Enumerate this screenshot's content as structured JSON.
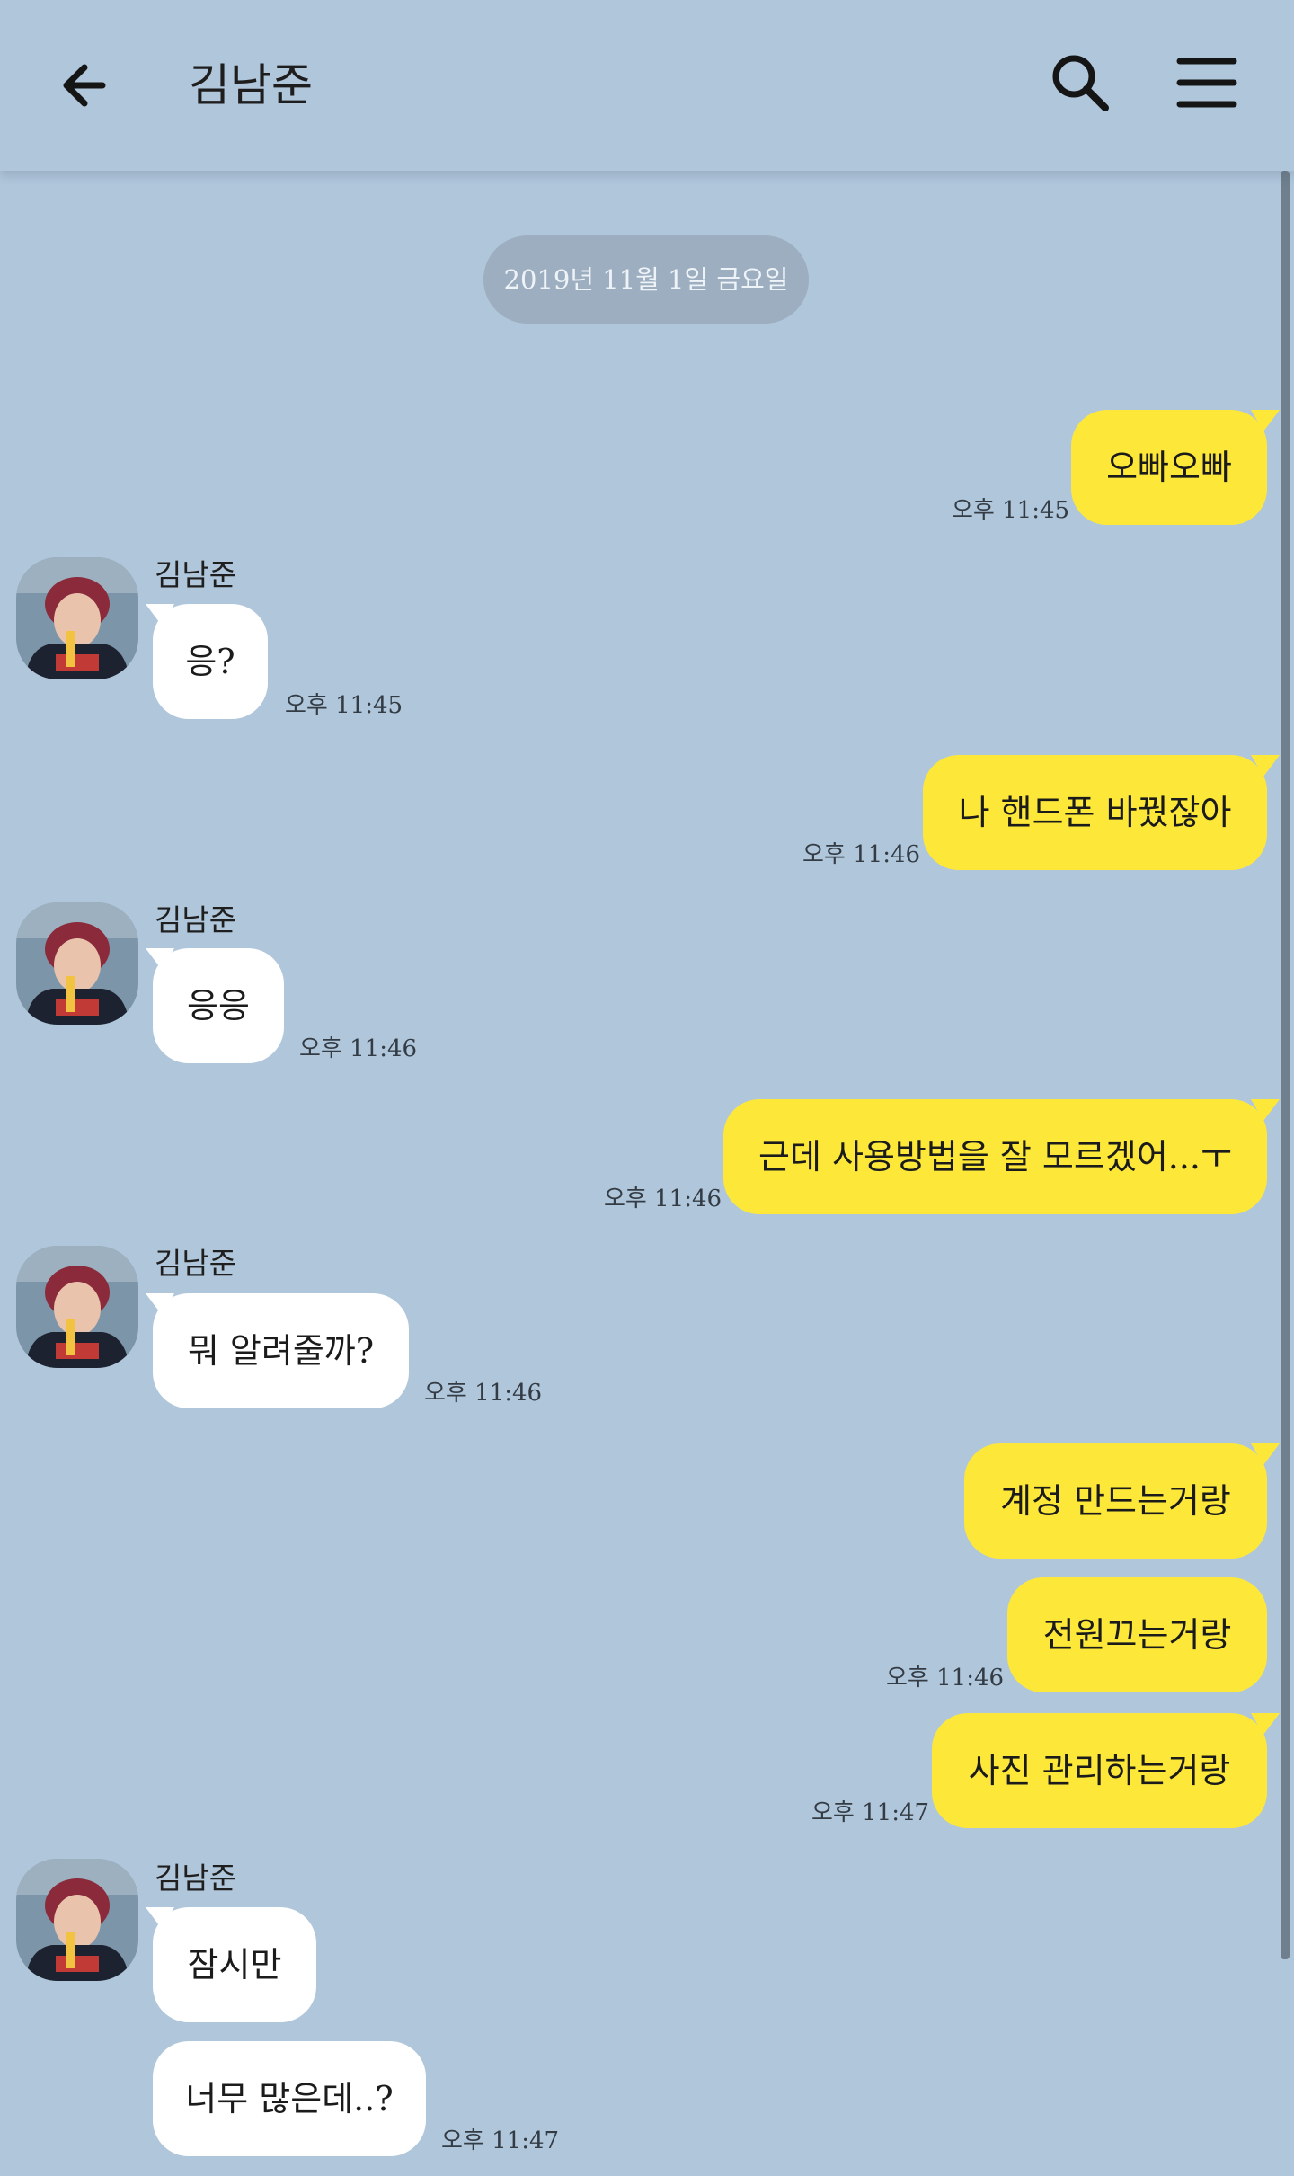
{
  "header": {
    "title": "김남준",
    "back_icon": "arrow-left-icon",
    "search_icon": "search-icon",
    "menu_icon": "hamburger-menu-icon"
  },
  "date_divider": "2019년 11월 1일 금요일",
  "colors": {
    "background": "#b0c6db",
    "my_bubble": "#fde83a",
    "their_bubble": "#ffffff",
    "date_pill": "#9caebf"
  },
  "messages": [
    {
      "from": "me",
      "text": "오빠오빠",
      "time": "오후 11:45"
    },
    {
      "from": "them",
      "sender": "김남준",
      "text": "응?",
      "time": "오후 11:45"
    },
    {
      "from": "me",
      "text": "나 핸드폰 바꿨잖아",
      "time": "오후 11:46"
    },
    {
      "from": "them",
      "sender": "김남준",
      "text": "응응",
      "time": "오후 11:46"
    },
    {
      "from": "me",
      "text": "근데 사용방법을 잘 모르겠어...ㅜ",
      "time": "오후 11:46"
    },
    {
      "from": "them",
      "sender": "김남준",
      "text": "뭐 알려줄까?",
      "time": "오후 11:46"
    },
    {
      "from": "me",
      "text": "계정 만드는거랑"
    },
    {
      "from": "me",
      "text": "전원끄는거랑",
      "time": "오후 11:46"
    },
    {
      "from": "me",
      "text": "사진 관리하는거랑",
      "time": "오후 11:47"
    },
    {
      "from": "them",
      "sender": "김남준",
      "text": "잠시만"
    },
    {
      "from": "them",
      "text": "너무 많은데..?",
      "time": "오후 11:47"
    }
  ]
}
